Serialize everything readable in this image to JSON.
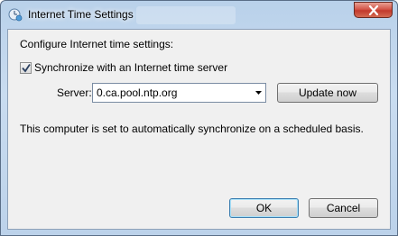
{
  "window": {
    "title": "Internet Time Settings",
    "close_icon": "close-icon",
    "app_icon": "clock-globe-icon"
  },
  "content": {
    "group_label": "Configure Internet time settings:",
    "sync_checkbox": {
      "label": "Synchronize with an Internet time server",
      "checked": true
    },
    "server": {
      "label": "Server:",
      "value": "0.ca.pool.ntp.org",
      "dropdown_icon": "chevron-down-icon"
    },
    "update_button": "Update now",
    "info_text": "This computer is set to automatically synchronize on a scheduled basis."
  },
  "buttons": {
    "ok": "OK",
    "cancel": "Cancel"
  },
  "colors": {
    "frame": "#b9d1ea",
    "client_bg": "#f0f0f0",
    "close_button": "#c2392c"
  }
}
